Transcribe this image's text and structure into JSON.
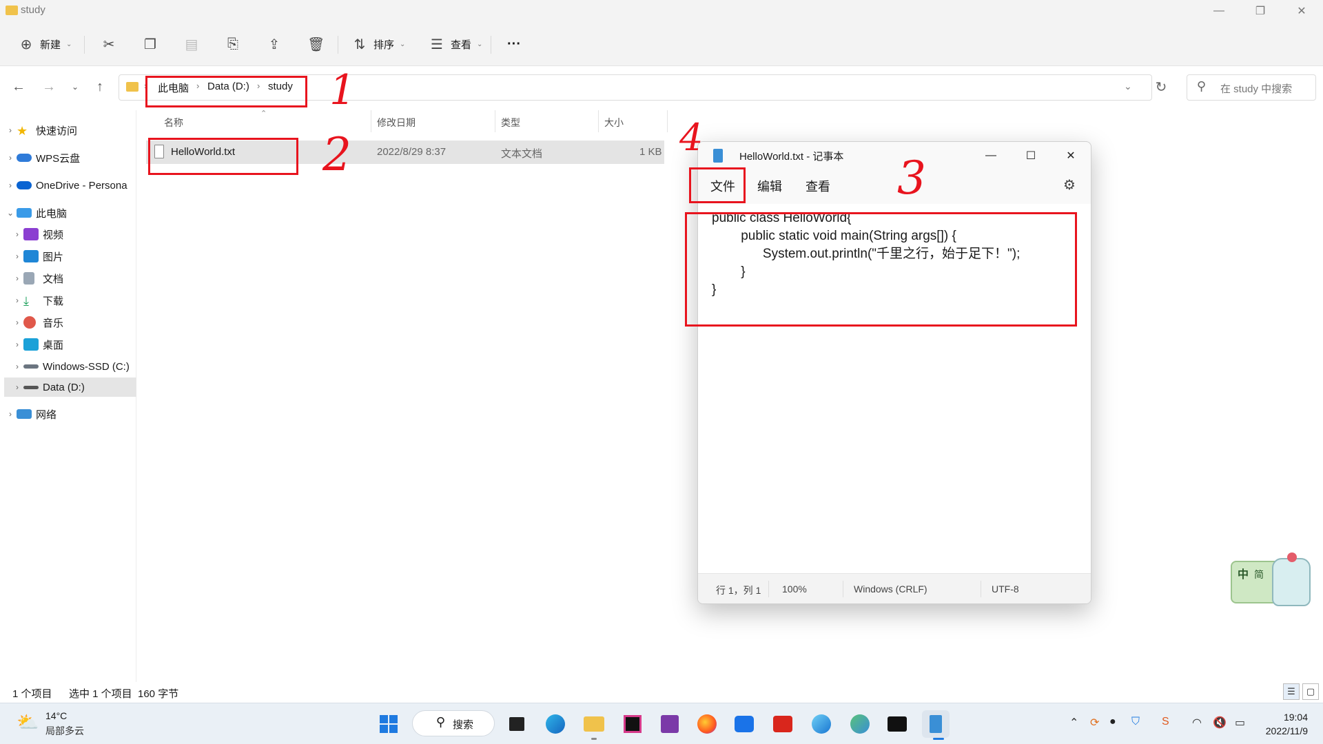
{
  "explorer": {
    "title": "study",
    "toolbar": {
      "new": "新建",
      "sort": "排序",
      "view": "查看",
      "more": "···"
    },
    "breadcrumb": [
      "此电脑",
      "Data (D:)",
      "study"
    ],
    "search_placeholder": "在 study 中搜索",
    "sidebar": {
      "quick_access": "快速访问",
      "wps": "WPS云盘",
      "onedrive": "OneDrive - Persona",
      "this_pc": "此电脑",
      "videos": "视频",
      "pictures": "图片",
      "documents": "文档",
      "downloads": "下载",
      "music": "音乐",
      "desktop": "桌面",
      "drive_c": "Windows-SSD (C:)",
      "drive_d": "Data (D:)",
      "network": "网络"
    },
    "columns": {
      "name": "名称",
      "modified": "修改日期",
      "type": "类型",
      "size": "大小"
    },
    "files": [
      {
        "name": "HelloWorld.txt",
        "modified": "2022/8/29 8:37",
        "type": "文本文档",
        "size": "1 KB"
      }
    ],
    "status": {
      "count": "1 个项目",
      "selected": "选中 1 个项目",
      "bytes": "160 字节"
    }
  },
  "notepad": {
    "title": "HelloWorld.txt - 记事本",
    "menu": {
      "file": "文件",
      "edit": "编辑",
      "view": "查看"
    },
    "content": "public class HelloWorld{\n        public static void main(String args[]) {\n              System.out.println(\"千里之行，始于足下！\");\n        }\n}",
    "status": {
      "position": "行 1，列 1",
      "zoom": "100%",
      "line_ending": "Windows (CRLF)",
      "encoding": "UTF-8"
    }
  },
  "annotations": [
    "1",
    "2",
    "3",
    "4"
  ],
  "sticker": {
    "label_top": "中",
    "label_right": "简"
  },
  "taskbar": {
    "weather_temp": "14°C",
    "weather_desc": "局部多云",
    "search": "搜索",
    "time": "19:04",
    "date": "2022/11/9"
  },
  "colors": {
    "annotation_red": "#e8141e",
    "folder_yellow": "#f0c24b",
    "selection_gray": "#e4e4e4"
  }
}
